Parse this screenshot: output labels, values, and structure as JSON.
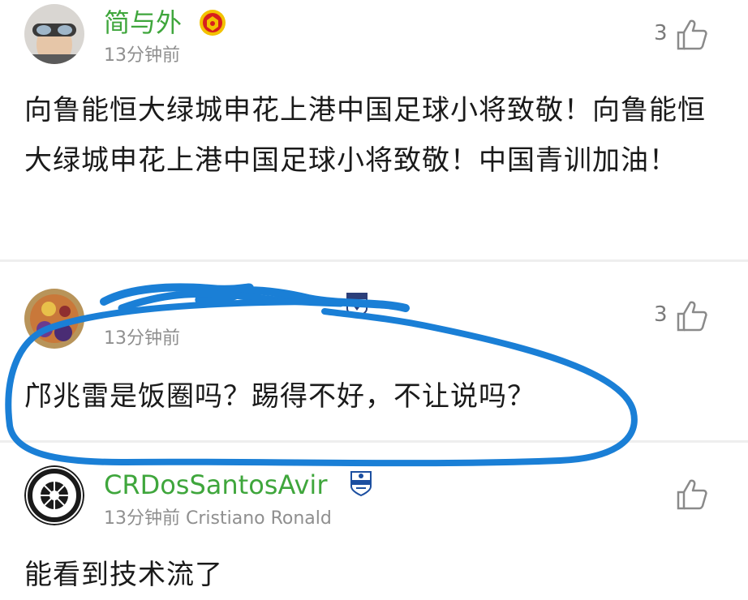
{
  "comments": [
    {
      "username": "简与外",
      "badge": "manchester-united-badge-icon",
      "time": "13分钟前",
      "likes": "3",
      "text": "向鲁能恒大绿城申花上港中国足球小将致敬！向鲁能恒大绿城申花上港中国足球小将致敬！中国青训加油！"
    },
    {
      "username": "",
      "badge": "team-badge-icon",
      "time": "13分钟前",
      "likes": "3",
      "text": "邝兆雷是饭圈吗？踢得不好，不让说吗？"
    },
    {
      "username": "CRDosSantosAvir",
      "badge": "club-crest-icon",
      "time": "13分钟前",
      "subtitle": "Cristiano Ronald",
      "likes": "",
      "text": "能看到技术流了"
    }
  ],
  "colors": {
    "username": "#3fa63c",
    "time": "#8f8f8f",
    "highlight": "#1a7fd6",
    "divider": "#eeeeee"
  }
}
